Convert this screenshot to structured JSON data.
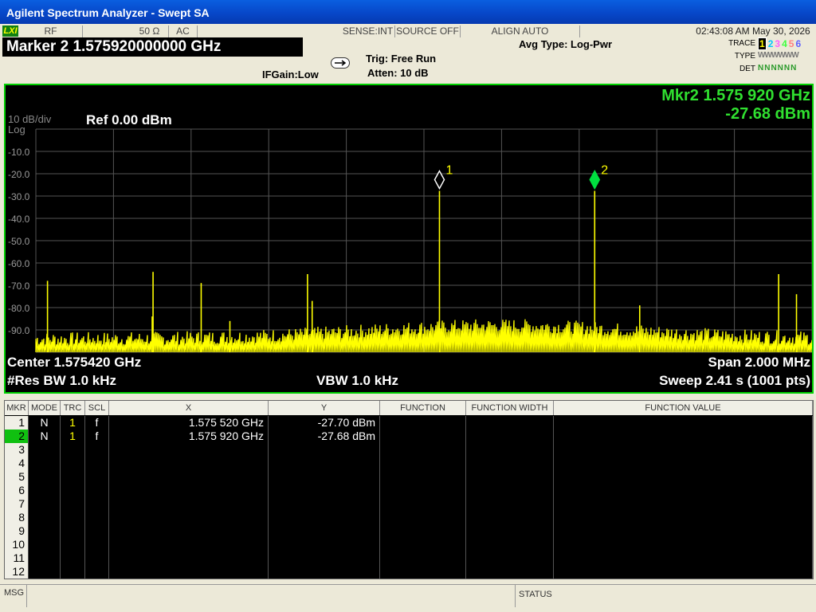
{
  "window": {
    "title": "Agilent Spectrum Analyzer - Swept SA"
  },
  "status_bar": {
    "lxi": "LXI",
    "rf": "RF",
    "impedance": "50 Ω",
    "coupling": "AC",
    "sense": "SENSE:INT",
    "source": "SOURCE OFF",
    "align": "ALIGN AUTO",
    "datetime": "02:43:08 AM May 30, 2026"
  },
  "marker_readout": "Marker 2  1.575920000000 GHz",
  "ifgain": "IFGain:Low",
  "trig": "Trig: Free Run",
  "atten": "Atten: 10 dB",
  "avg_type": "Avg Type: Log-Pwr",
  "trace_panel": {
    "trace_label": "TRACE",
    "type_label": "TYPE",
    "det_label": "DET",
    "trace_numbers": [
      "1",
      "2",
      "3",
      "4",
      "5",
      "6"
    ],
    "trace_colors": [
      "#ffff00",
      "#00c8ff",
      "#ff60ff",
      "#40ff40",
      "#ff8080",
      "#6060ff"
    ],
    "type_value": "WWWWWW",
    "det_value": "NNNNNN"
  },
  "display": {
    "scale": "10 dB/div",
    "mode": "Log",
    "ref_level": "Ref 0.00 dBm",
    "mkr_freq": "Mkr2 1.575 920 GHz",
    "mkr_level": "-27.68 dBm",
    "center": "Center 1.575420 GHz",
    "span": "Span 2.000 MHz",
    "res_bw": "#Res BW 1.0 kHz",
    "vbw": "VBW 1.0 kHz",
    "sweep": "Sweep  2.41 s (1001 pts)",
    "y_ticks": [
      "-10.0",
      "-20.0",
      "-30.0",
      "-40.0",
      "-50.0",
      "-60.0",
      "-70.0",
      "-80.0",
      "-90.0"
    ],
    "markers": [
      {
        "label": "1",
        "x_frac": 0.52,
        "level": -27.7,
        "active": false
      },
      {
        "label": "2",
        "x_frac": 0.72,
        "level": -27.68,
        "active": true
      }
    ],
    "trace_color": "#ffff00",
    "graticule_color": "#555555",
    "border_color": "#00d000"
  },
  "chart_data": {
    "type": "line",
    "ylim": [
      -100,
      0
    ],
    "xlabel": "",
    "ylabel": "",
    "series": [
      {
        "values_desc": "",
        "spikes": [
          {
            "x_frac": 0.015,
            "level": -68
          },
          {
            "x_frac": 0.15,
            "level": -84
          },
          {
            "x_frac": 0.15,
            "level": -84
          },
          {
            "x_frac": 0.151,
            "level": -64
          },
          {
            "x_frac": 0.213,
            "level": -69
          },
          {
            "x_frac": 0.25,
            "level": -86
          },
          {
            "x_frac": 0.35,
            "level": -65
          },
          {
            "x_frac": 0.356,
            "level": -77
          },
          {
            "x_frac": 0.52,
            "level": -27.7
          },
          {
            "x_frac": 0.72,
            "level": -27.68
          },
          {
            "x_frac": 0.778,
            "level": -79
          },
          {
            "x_frac": 0.957,
            "level": -65
          },
          {
            "x_frac": 0.98,
            "level": -74
          }
        ]
      }
    ]
  },
  "marker_table": {
    "headers": [
      "MKR",
      "MODE",
      "TRC",
      "SCL",
      "X",
      "Y",
      "FUNCTION",
      "FUNCTION WIDTH",
      "FUNCTION VALUE"
    ],
    "rows": [
      {
        "mkr": "1",
        "mode": "N",
        "trc": "1",
        "scl": "f",
        "x": "1.575 520 GHz",
        "y": "-27.70 dBm"
      },
      {
        "mkr": "2",
        "mode": "N",
        "trc": "1",
        "scl": "f",
        "x": "1.575 920 GHz",
        "y": "-27.68 dBm"
      },
      {
        "mkr": "3"
      },
      {
        "mkr": "4"
      },
      {
        "mkr": "5"
      },
      {
        "mkr": "6"
      },
      {
        "mkr": "7"
      },
      {
        "mkr": "8"
      },
      {
        "mkr": "9"
      },
      {
        "mkr": "10"
      },
      {
        "mkr": "11"
      },
      {
        "mkr": "12"
      }
    ]
  },
  "bottom": {
    "msg": "MSG",
    "status": "STATUS"
  }
}
